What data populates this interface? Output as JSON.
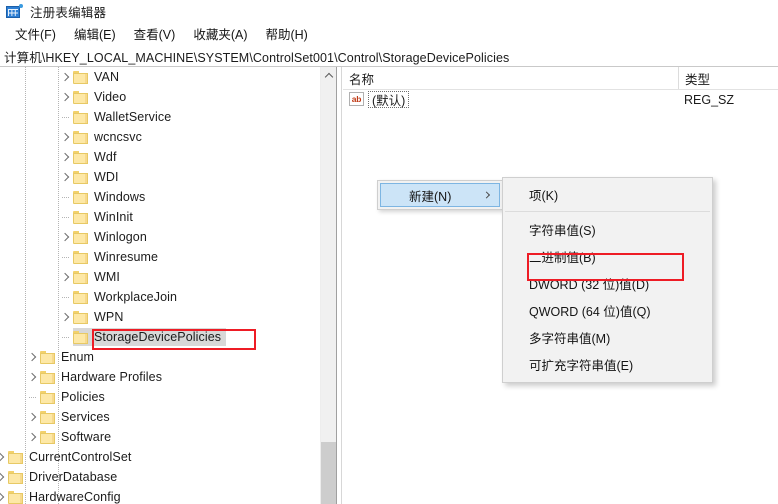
{
  "window": {
    "title": "注册表编辑器",
    "icon": "registry-editor-icon"
  },
  "menubar": {
    "items": [
      {
        "label": "文件(F)"
      },
      {
        "label": "编辑(E)"
      },
      {
        "label": "查看(V)"
      },
      {
        "label": "收藏夹(A)"
      },
      {
        "label": "帮助(H)"
      }
    ]
  },
  "address": {
    "path": "计算机\\HKEY_LOCAL_MACHINE\\SYSTEM\\ControlSet001\\Control\\StorageDevicePolicies"
  },
  "tree": {
    "items": [
      {
        "label": "VAN",
        "level": 3,
        "expandable": true,
        "selected": false
      },
      {
        "label": "Video",
        "level": 3,
        "expandable": true,
        "selected": false
      },
      {
        "label": "WalletService",
        "level": 3,
        "expandable": false,
        "selected": false
      },
      {
        "label": "wcncsvc",
        "level": 3,
        "expandable": true,
        "selected": false
      },
      {
        "label": "Wdf",
        "level": 3,
        "expandable": true,
        "selected": false
      },
      {
        "label": "WDI",
        "level": 3,
        "expandable": true,
        "selected": false
      },
      {
        "label": "Windows",
        "level": 3,
        "expandable": false,
        "selected": false
      },
      {
        "label": "WinInit",
        "level": 3,
        "expandable": false,
        "selected": false
      },
      {
        "label": "Winlogon",
        "level": 3,
        "expandable": true,
        "selected": false
      },
      {
        "label": "Winresume",
        "level": 3,
        "expandable": false,
        "selected": false
      },
      {
        "label": "WMI",
        "level": 3,
        "expandable": true,
        "selected": false
      },
      {
        "label": "WorkplaceJoin",
        "level": 3,
        "expandable": false,
        "selected": false
      },
      {
        "label": "WPN",
        "level": 3,
        "expandable": true,
        "selected": false
      },
      {
        "label": "StorageDevicePolicies",
        "level": 3,
        "expandable": false,
        "selected": true
      },
      {
        "label": "Enum",
        "level": 2,
        "expandable": true,
        "selected": false
      },
      {
        "label": "Hardware Profiles",
        "level": 2,
        "expandable": true,
        "selected": false
      },
      {
        "label": "Policies",
        "level": 2,
        "expandable": false,
        "selected": false
      },
      {
        "label": "Services",
        "level": 2,
        "expandable": true,
        "selected": false
      },
      {
        "label": "Software",
        "level": 2,
        "expandable": true,
        "selected": false
      },
      {
        "label": "CurrentControlSet",
        "level": 1,
        "expandable": true,
        "selected": false
      },
      {
        "label": "DriverDatabase",
        "level": 1,
        "expandable": true,
        "selected": false
      },
      {
        "label": "HardwareConfig",
        "level": 1,
        "expandable": true,
        "selected": false
      }
    ]
  },
  "value_list": {
    "columns": [
      {
        "label": "名称"
      },
      {
        "label": "类型"
      }
    ],
    "rows": [
      {
        "icon": "string-value-icon",
        "icon_text": "ab",
        "name": "(默认)",
        "type": "REG_SZ"
      }
    ]
  },
  "context_menu": {
    "new_label": "新建(N)",
    "submenu_items": [
      {
        "label": "项(K)",
        "separator_after": true,
        "highlighted": false
      },
      {
        "label": "字符串值(S)",
        "separator_after": false,
        "highlighted": false
      },
      {
        "label": "二进制值(B)",
        "separator_after": false,
        "highlighted": false
      },
      {
        "label": "DWORD (32 位)值(D)",
        "separator_after": false,
        "highlighted": true
      },
      {
        "label": "QWORD (64 位)值(Q)",
        "separator_after": false,
        "highlighted": false
      },
      {
        "label": "多字符串值(M)",
        "separator_after": false,
        "highlighted": false
      },
      {
        "label": "可扩充字符串值(E)",
        "separator_after": false,
        "highlighted": false
      }
    ]
  },
  "annotations": {
    "highlight_color": "#ee1c25",
    "tree_target": "StorageDevicePolicies",
    "menu_target": "DWORD (32 位)值(D)"
  }
}
